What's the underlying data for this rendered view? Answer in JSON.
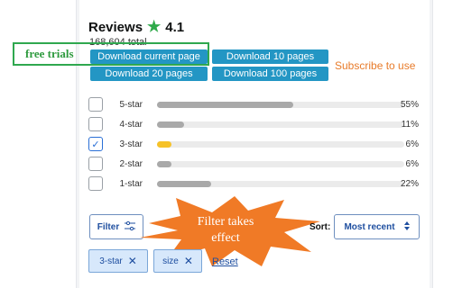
{
  "header": {
    "title": "Reviews",
    "star_icon": "star-icon",
    "rating": "4.1",
    "total": "168,604 total"
  },
  "annotations": {
    "free_trials": "free trials",
    "subscribe": "Subscribe to use",
    "filter_effect_line1": "Filter takes",
    "filter_effect_line2": "effect"
  },
  "downloads": {
    "current_page": "Download current page",
    "ten_pages": "Download 10 pages",
    "twenty_pages": "Download 20 pages",
    "hundred_pages": "Download 100 pages"
  },
  "ratings": [
    {
      "label": "5-star",
      "percent": "55%",
      "fraction": 0.55,
      "checked": false
    },
    {
      "label": "4-star",
      "percent": "11%",
      "fraction": 0.11,
      "checked": false
    },
    {
      "label": "3-star",
      "percent": "6%",
      "fraction": 0.06,
      "checked": true
    },
    {
      "label": "2-star",
      "percent": "6%",
      "fraction": 0.06,
      "checked": false
    },
    {
      "label": "1-star",
      "percent": "22%",
      "fraction": 0.22,
      "checked": false
    }
  ],
  "filter": {
    "label": "Filter",
    "icon": "sliders-icon"
  },
  "sort": {
    "label": "Sort:",
    "selected": "Most recent",
    "icon": "up-down-chevron-icon"
  },
  "chips": [
    {
      "label": "3-star"
    },
    {
      "label": "size"
    }
  ],
  "reset_label": "Reset",
  "colors": {
    "download_button": "#2396c4",
    "free_trial_green": "#2fa84f",
    "subscribe_orange": "#e87b2a",
    "burst_orange": "#f07a26",
    "star_green": "#2faa4a",
    "active_bar": "#f6c228",
    "bar": "#a9a9a9"
  }
}
